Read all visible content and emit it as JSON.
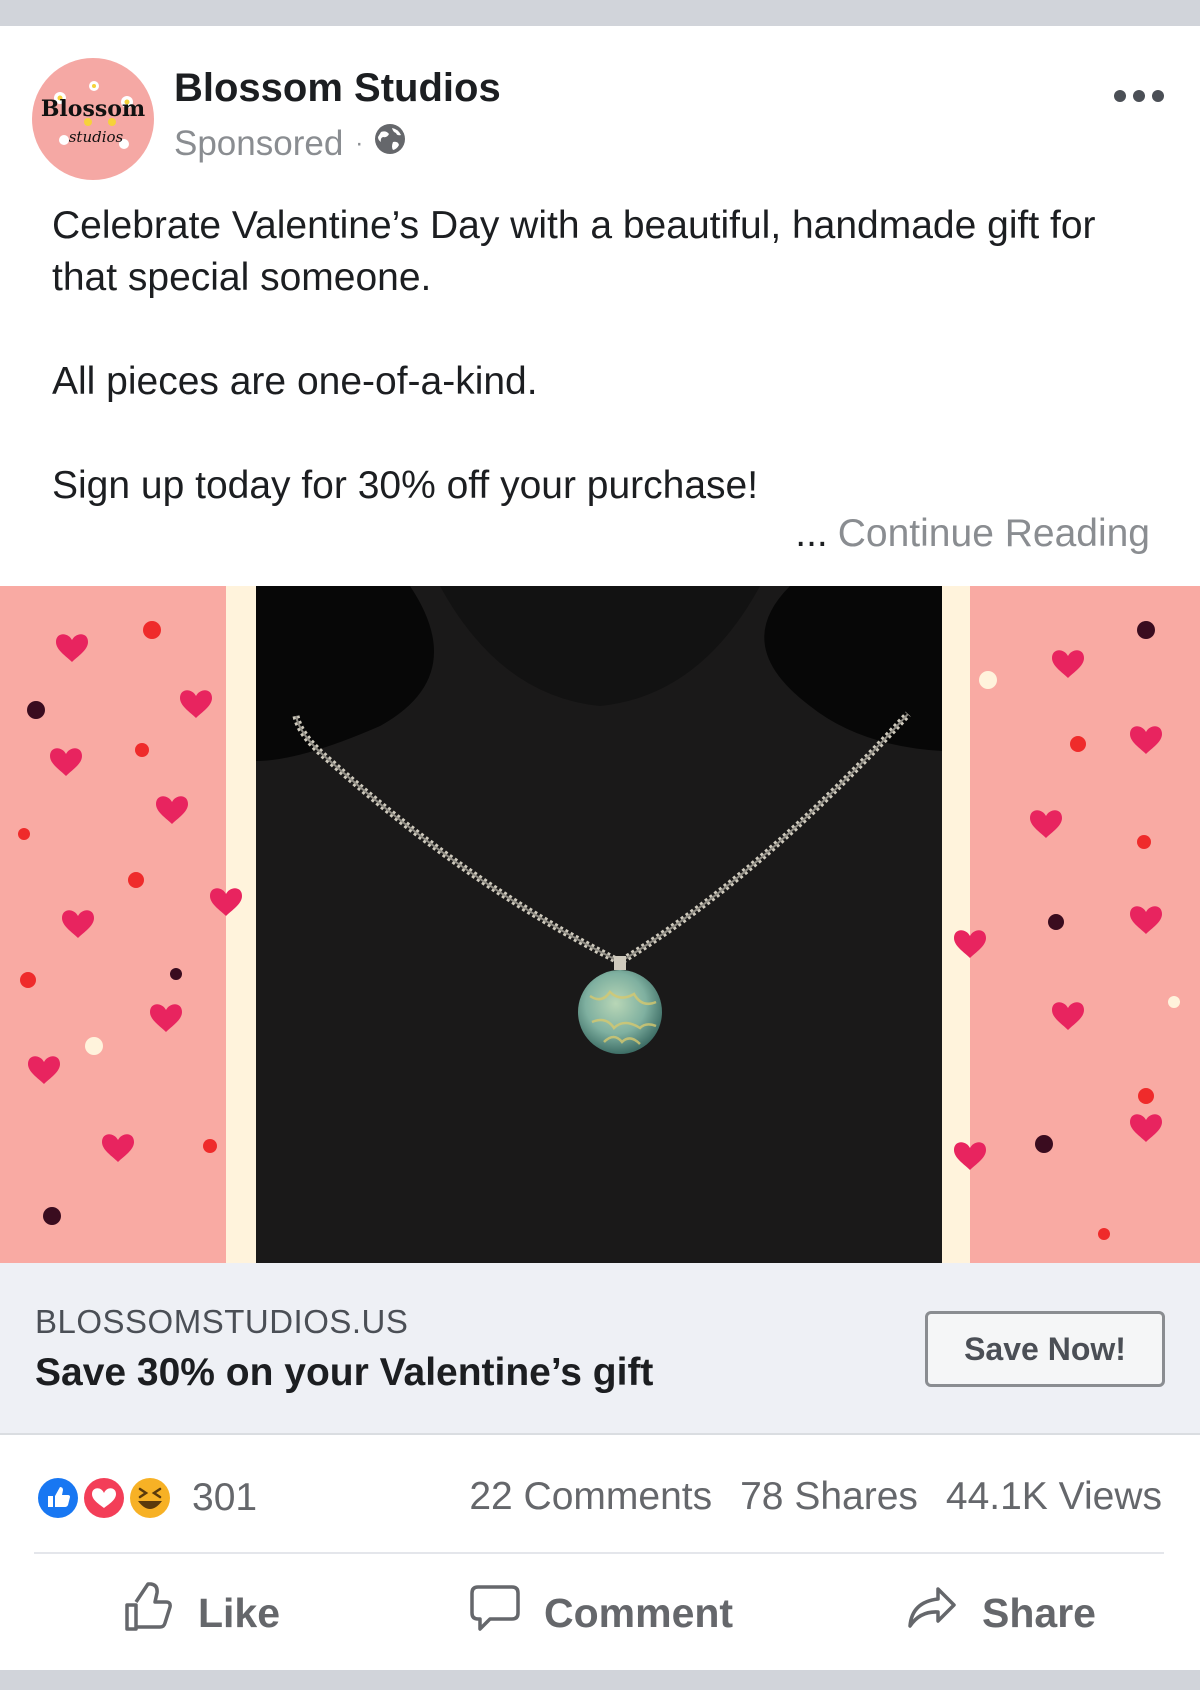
{
  "post": {
    "page_name": "Blossom Studios",
    "logo_text_1": "Blossom",
    "logo_text_2": "studios",
    "sponsored": "Sponsored",
    "separator": "·",
    "privacy_icon": "globe-icon",
    "more_icon": "more-options-icon",
    "text_paragraphs": [
      "Celebrate Valentine’s Day with a beautiful, handmade gift for that special someone.",
      "All pieces are one-of-a-kind.",
      "Sign up today for 30% off your purchase!"
    ],
    "ellipsis": "...",
    "continue_label": "Continue Reading"
  },
  "link_card": {
    "domain": "BLOSSOMSTUDIOS.US",
    "headline": "Save 30% on your Valentine’s gift",
    "cta_label": "Save Now!"
  },
  "stats": {
    "reaction_icons": [
      "like-reaction-icon",
      "love-reaction-icon",
      "haha-reaction-icon"
    ],
    "reaction_count": "301",
    "comments": "22 Comments",
    "shares": "78 Shares",
    "views": "44.1K Views"
  },
  "actions": {
    "like": "Like",
    "comment": "Comment",
    "share": "Share"
  },
  "colors": {
    "pink_panel": "#f9aaa3",
    "heart": "#e8245f",
    "cream_border": "#fff3dc",
    "like_blue": "#1877f2",
    "love_red": "#f33e58",
    "haha_yellow": "#f7b125"
  }
}
